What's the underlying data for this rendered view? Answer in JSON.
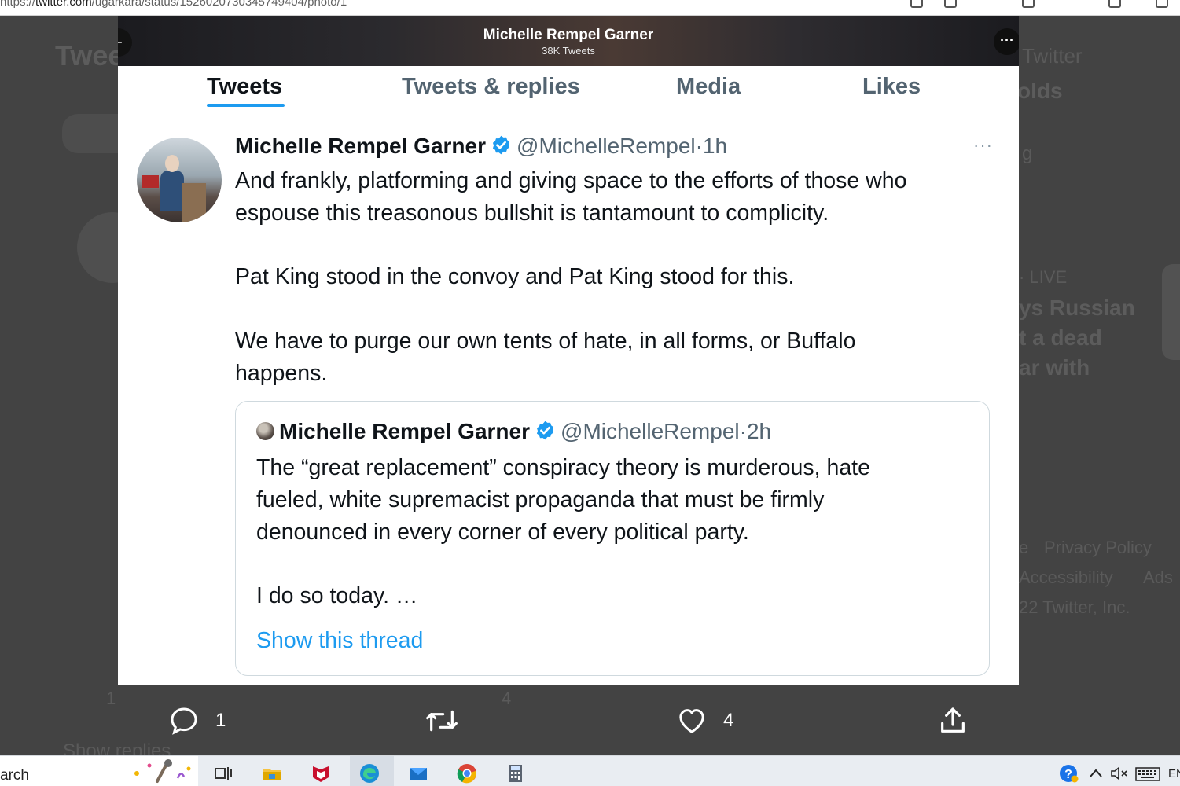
{
  "browser": {
    "url_prefix": "https://",
    "url_host": "twitter.com",
    "url_path": "/ugarkara/status/1526020730345749404/photo/1"
  },
  "background_page": {
    "header": "Twee",
    "right_header": "Twitter",
    "right_bold": "olds",
    "right_small": "g",
    "live_label": "LIVE",
    "trend_lines": [
      "ys Russian",
      "t a dead",
      "ar with"
    ],
    "footer_links": [
      "e",
      "Privacy Policy",
      "Accessibility",
      "Ads"
    ],
    "copyright": "22 Twitter, Inc.",
    "reply_count": "1",
    "like_count": "4",
    "show_replies": "Show replies"
  },
  "modal": {
    "header": {
      "title": "Michelle Rempel Garner",
      "subtitle": "38K Tweets"
    },
    "tabs": [
      {
        "label": "Tweets"
      },
      {
        "label": "Tweets & replies"
      },
      {
        "label": "Media"
      },
      {
        "label": "Likes"
      }
    ],
    "tweet": {
      "name": "Michelle Rempel Garner",
      "handle": "@MichelleRempel",
      "sep": "·",
      "time": "1h",
      "more": "···",
      "lines": [
        "And frankly, platforming and giving space to the efforts of those who",
        "espouse this treasonous bullshit is tantamount to complicity.",
        "Pat King stood in the convoy and Pat King stood for this.",
        "We have to purge our own tents of hate, in all forms, or Buffalo",
        "happens."
      ],
      "quote": {
        "name": "Michelle Rempel Garner",
        "handle": "@MichelleRempel",
        "sep": "·",
        "time": "2h",
        "lines": [
          "The “great replacement” conspiracy theory is murderous, hate",
          "fueled, white supremacist propaganda that must be firmly",
          "denounced in every corner of every political party.",
          "I do so today. …"
        ],
        "show_thread": "Show this thread"
      }
    }
  },
  "actions": {
    "reply_count": "1",
    "like_count": "4"
  },
  "taskbar": {
    "search_text": "arch",
    "language": "EN",
    "icons": [
      "task-view-icon",
      "file-explorer-icon",
      "mcafee-icon",
      "edge-icon",
      "mail-icon",
      "chrome-icon",
      "calculator-icon"
    ]
  },
  "colors": {
    "accent": "#1d9bf0",
    "text": "#0f1419",
    "muted": "#536471"
  }
}
